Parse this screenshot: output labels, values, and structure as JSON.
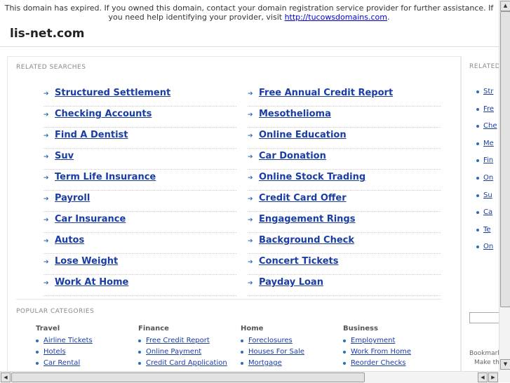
{
  "notice": {
    "text": "This domain has expired. If you owned this domain, contact your domain registration service provider for further assistance. If you need help identifying your provider, visit ",
    "link": "http://tucowsdomains.com",
    "end": "."
  },
  "domain": "lis-net.com",
  "related": {
    "title": "RELATED SEARCHES",
    "left": [
      "Structured Settlement",
      "Checking Accounts",
      "Find A Dentist",
      "Suv",
      "Term Life Insurance",
      "Payroll",
      "Car Insurance",
      "Autos",
      "Lose Weight",
      "Work At Home"
    ],
    "right": [
      "Free Annual Credit Report",
      "Mesothelioma",
      "Online Education",
      "Car Donation",
      "Online Stock Trading",
      "Credit Card Offer",
      "Engagement Rings",
      "Background Check",
      "Concert Tickets",
      "Payday Loan"
    ]
  },
  "popular": {
    "title": "POPULAR CATEGORIES",
    "categories": [
      {
        "name": "Travel",
        "links": [
          "Airline Tickets",
          "Hotels",
          "Car Rental"
        ]
      },
      {
        "name": "Finance",
        "links": [
          "Free Credit Report",
          "Online Payment",
          "Credit Card Application"
        ]
      },
      {
        "name": "Home",
        "links": [
          "Foreclosures",
          "Houses For Sale",
          "Mortgage"
        ]
      },
      {
        "name": "Business",
        "links": [
          "Employment",
          "Work From Home",
          "Reorder Checks"
        ]
      }
    ]
  },
  "side": {
    "title": "RELATED",
    "links": [
      "Str",
      "Fre",
      "Che",
      "Me",
      "Fin",
      "On",
      "Su",
      "Ca",
      "Te",
      "On"
    ],
    "bookmark": "Bookmark",
    "make": "Make thi"
  },
  "icons": {
    "arrow": "right-arrow-icon",
    "bullet": "bullet-icon"
  },
  "colors": {
    "link": "#1a3da3",
    "accent": "#2a6ebb"
  }
}
